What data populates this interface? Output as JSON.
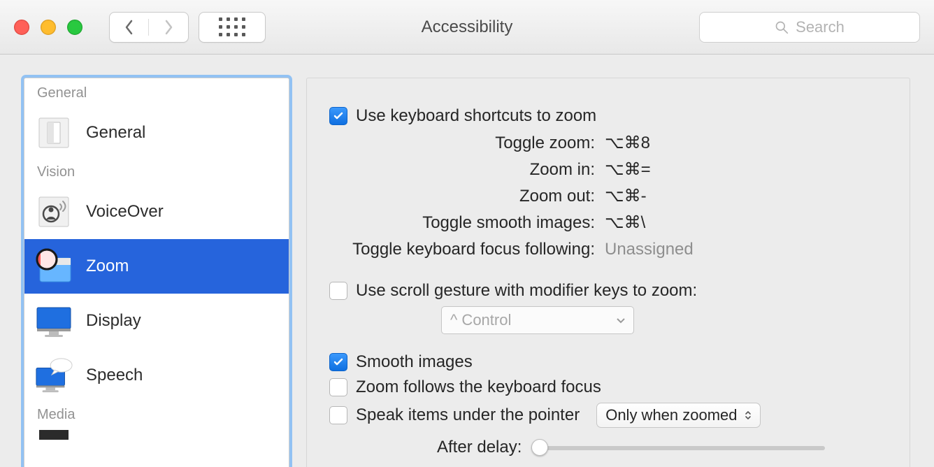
{
  "window": {
    "title": "Accessibility",
    "search_placeholder": "Search"
  },
  "sidebar": {
    "sections": {
      "general": "General",
      "vision": "Vision",
      "media": "Media"
    },
    "items": {
      "general": "General",
      "voiceover": "VoiceOver",
      "zoom": "Zoom",
      "display": "Display",
      "speech": "Speech"
    }
  },
  "main": {
    "use_keyboard_shortcuts": "Use keyboard shortcuts to zoom",
    "shortcuts": {
      "toggle_zoom": {
        "label": "Toggle zoom:",
        "value": "⌥⌘8"
      },
      "zoom_in": {
        "label": "Zoom in:",
        "value": "⌥⌘="
      },
      "zoom_out": {
        "label": "Zoom out:",
        "value": "⌥⌘-"
      },
      "toggle_smooth": {
        "label": "Toggle smooth images:",
        "value": "⌥⌘\\"
      },
      "toggle_focus": {
        "label": "Toggle keyboard focus following:",
        "value": "Unassigned"
      }
    },
    "use_scroll_gesture": "Use scroll gesture with modifier keys to zoom:",
    "modifier_value": "^ Control",
    "smooth_images": "Smooth images",
    "zoom_follows_focus": "Zoom follows the keyboard focus",
    "speak_items": "Speak items under the pointer",
    "speak_mode": "Only when zoomed",
    "after_delay": "After delay:"
  }
}
